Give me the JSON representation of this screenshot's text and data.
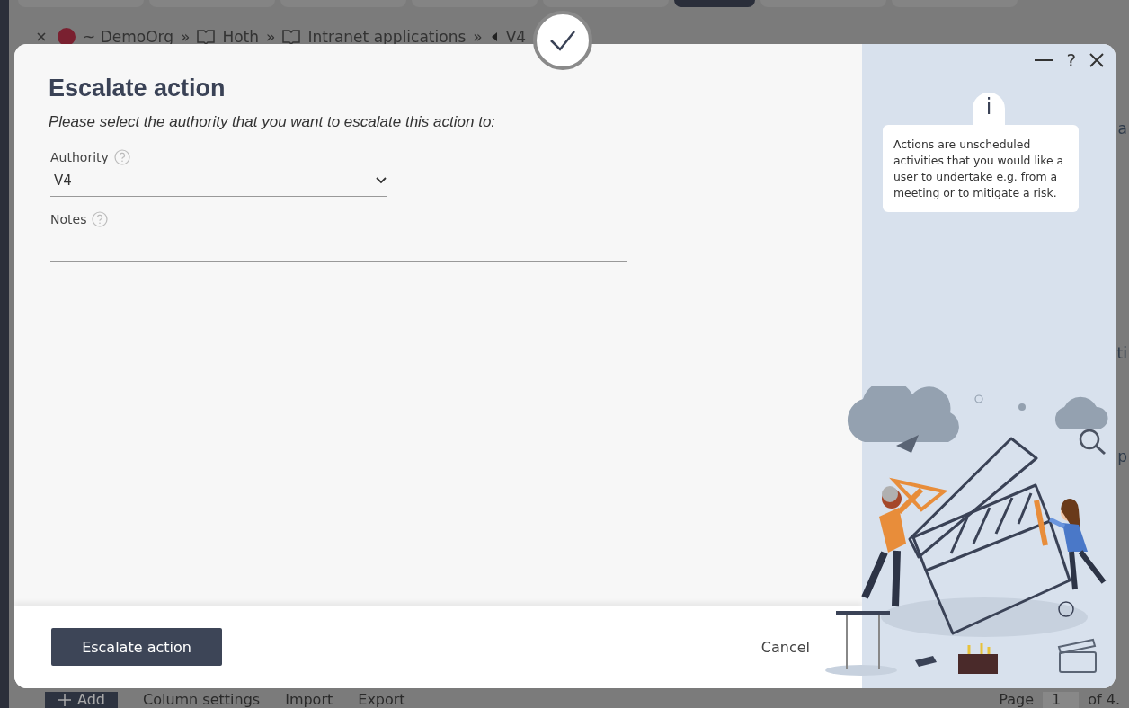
{
  "background": {
    "tabs": [
      {
        "selected": false
      },
      {
        "selected": false
      },
      {
        "selected": false
      },
      {
        "selected": false
      },
      {
        "selected": false
      },
      {
        "selected": true
      },
      {
        "selected": false
      },
      {
        "selected": false
      }
    ],
    "breadcrumb": [
      {
        "kind": "org",
        "label": "~ DemoOrg"
      },
      {
        "kind": "book",
        "label": "Hoth"
      },
      {
        "kind": "book",
        "label": "Intranet applications"
      },
      {
        "kind": "back",
        "label": "V4"
      }
    ],
    "separator": "»",
    "side_fragments": [
      "a",
      "ti",
      ".p"
    ],
    "toolbar": {
      "add": "Add",
      "column_settings": "Column settings",
      "import": "Import",
      "export": "Export",
      "page_label": "Page",
      "page_value": "1",
      "page_total": "of 4."
    }
  },
  "dialog": {
    "title": "Escalate action",
    "instruction": "Please select the authority that you want to escalate this action to:",
    "fields": [
      {
        "kind": "select",
        "label": "Authority",
        "value": "V4"
      },
      {
        "kind": "text",
        "label": "Notes"
      }
    ],
    "primary_button": "Escalate action",
    "cancel_button": "Cancel",
    "help_button": "?",
    "info": {
      "icon": "i",
      "text": "Actions are unscheduled activities that you would like a user to undertake e.g. from a meeting or to mitigate a risk."
    }
  }
}
